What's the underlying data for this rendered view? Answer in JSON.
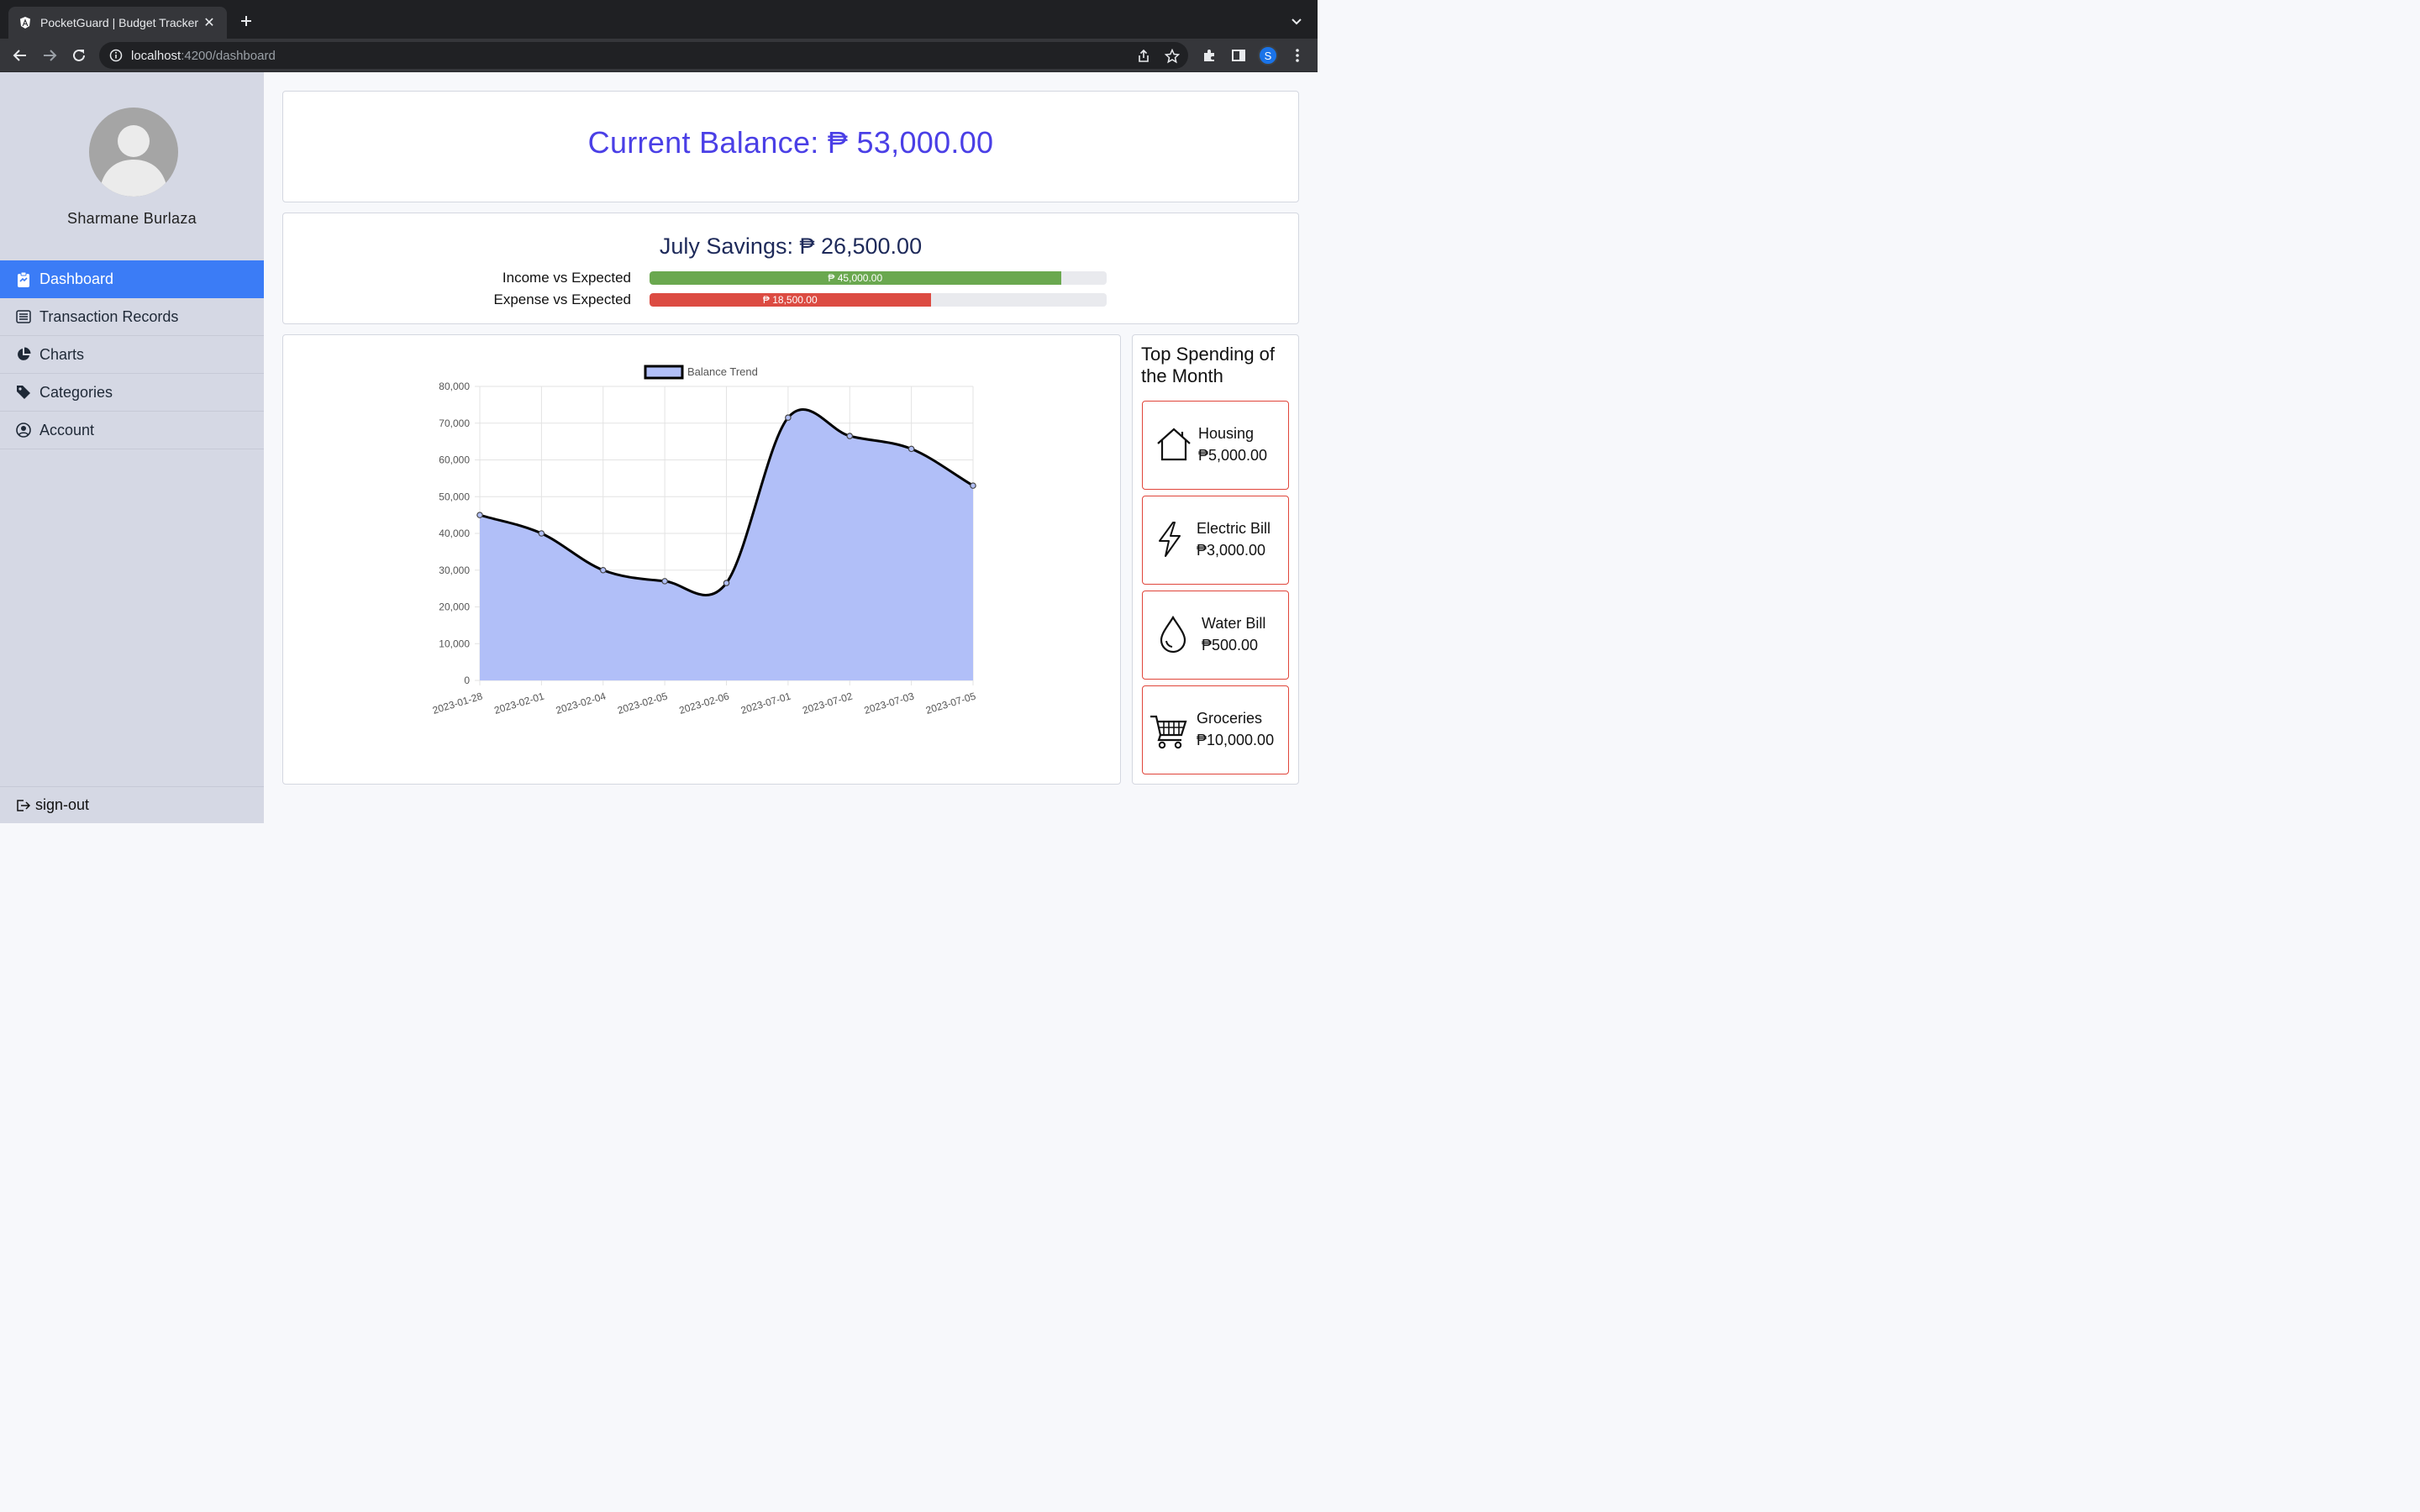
{
  "browser": {
    "tab_title": "PocketGuard | Budget Tracker",
    "url_host": "localhost",
    "url_rest": ":4200/dashboard",
    "profile_initial": "S"
  },
  "sidebar": {
    "user_name": "Sharmane Burlaza",
    "items": [
      {
        "label": "Dashboard",
        "icon": "clipboard-icon",
        "active": true
      },
      {
        "label": "Transaction Records",
        "icon": "list-icon",
        "active": false
      },
      {
        "label": "Charts",
        "icon": "pie-chart-icon",
        "active": false
      },
      {
        "label": "Categories",
        "icon": "tag-icon",
        "active": false
      },
      {
        "label": "Account",
        "icon": "user-circle-icon",
        "active": false
      }
    ],
    "signout_label": "sign-out"
  },
  "balance": {
    "text": "Current Balance: ₱ 53,000.00"
  },
  "savings": {
    "title": "July Savings: ₱ 26,500.00",
    "income_label": "Income vs Expected",
    "income_value": "₱ 45,000.00",
    "income_fraction": 0.9,
    "expense_label": "Expense vs Expected",
    "expense_value": "₱ 18,500.00",
    "expense_fraction": 0.615,
    "income_color": "#6aa84f",
    "expense_color": "#dc4b42"
  },
  "chart_data": {
    "type": "area",
    "legend": "Balance Trend",
    "categories": [
      "2023-01-28",
      "2023-02-01",
      "2023-02-04",
      "2023-02-05",
      "2023-02-06",
      "2023-07-01",
      "2023-07-02",
      "2023-07-03",
      "2023-07-05"
    ],
    "values": [
      45000,
      40000,
      30000,
      27000,
      26500,
      71500,
      66500,
      63000,
      53000
    ],
    "ylim": [
      0,
      80000
    ],
    "yticks": [
      "0",
      "10,000",
      "20,000",
      "30,000",
      "40,000",
      "50,000",
      "60,000",
      "70,000",
      "80,000"
    ],
    "fill_color": "#b1bff8",
    "line_color": "#000000",
    "grid": true,
    "legend_position": "top"
  },
  "top_spending": {
    "title": "Top Spending of the Month",
    "items": [
      {
        "name": "Housing",
        "amount": "₱5,000.00",
        "icon": "house-icon"
      },
      {
        "name": "Electric Bill",
        "amount": "₱3,000.00",
        "icon": "lightning-icon"
      },
      {
        "name": "Water Bill",
        "amount": "₱500.00",
        "icon": "water-drop-icon"
      },
      {
        "name": "Groceries",
        "amount": "₱10,000.00",
        "icon": "shopping-cart-icon"
      }
    ],
    "border_color": "#e0453a"
  }
}
